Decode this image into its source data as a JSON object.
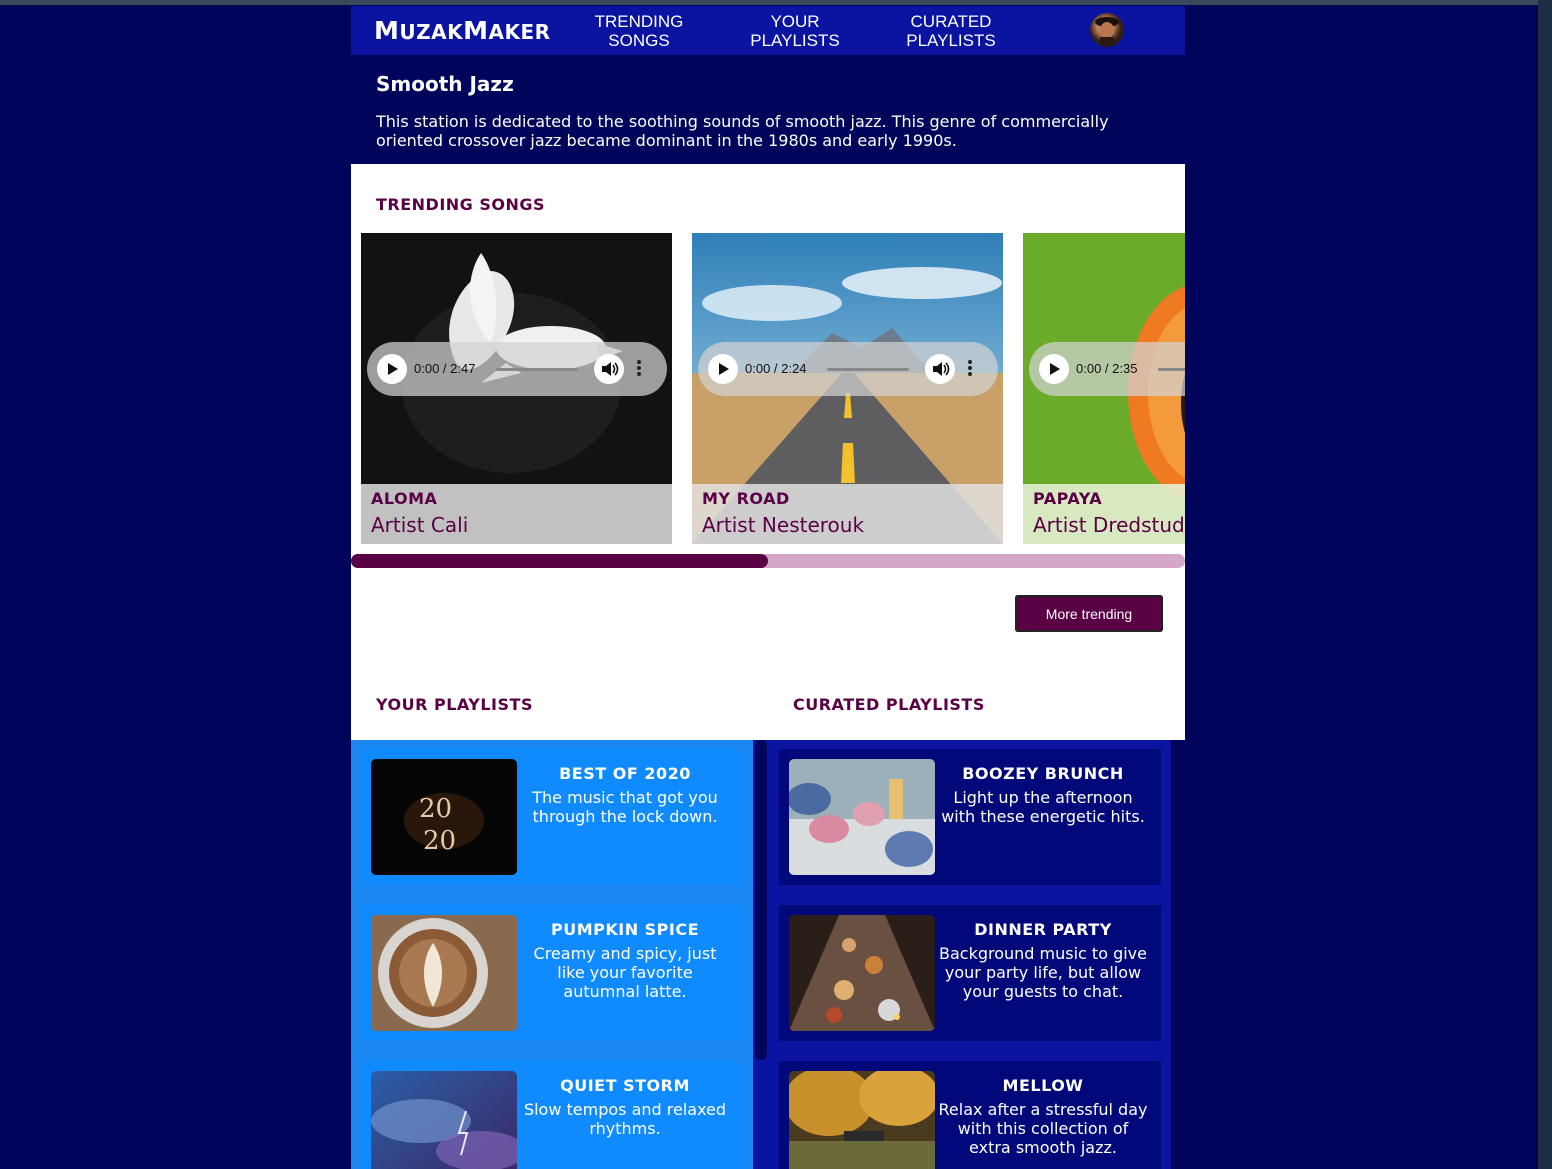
{
  "app": {
    "logo_first_big": "M",
    "logo_first_rest": "UZAK",
    "logo_second_big": "M",
    "logo_second_rest": "AKER"
  },
  "nav": {
    "links": [
      {
        "line1": "TRENDING",
        "line2": "SONGS"
      },
      {
        "line1": "YOUR",
        "line2": "PLAYLISTS"
      },
      {
        "line1": "CURATED",
        "line2": "PLAYLISTS"
      }
    ]
  },
  "station": {
    "title": "Smooth Jazz",
    "description": "This station is dedicated to the soothing sounds of smooth jazz. This genre of commercially oriented crossover jazz became dominant in the 1980s and early 1990s."
  },
  "trending": {
    "heading": "TRENDING SONGS",
    "songs": [
      {
        "title": "ALOMA",
        "artist": "Artist  Cali",
        "time": "0:00 / 2:47",
        "progress": 0
      },
      {
        "title": "MY ROAD",
        "artist": "Artist  Nesterouk",
        "time": "0:00 / 2:24",
        "progress": 0
      },
      {
        "title": "PAPAYA",
        "artist": "Artist  Dredstudio",
        "time": "0:00 / 2:35",
        "progress": 0
      }
    ],
    "scroll_position": 0.5,
    "more_label": "More trending"
  },
  "your_playlists": {
    "heading": "YOUR PLAYLISTS",
    "items": [
      {
        "title": "BEST OF 2020",
        "desc": "The music that got you through the lock down."
      },
      {
        "title": "PUMPKIN SPICE",
        "desc": "Creamy and spicy, just like your favorite autumnal latte."
      },
      {
        "title": "QUIET STORM",
        "desc": "Slow tempos and relaxed rhythms."
      }
    ]
  },
  "curated_playlists": {
    "heading": "CURATED PLAYLISTS",
    "items": [
      {
        "title": "BOOZEY BRUNCH",
        "desc": "Light up the afternoon with these energetic hits."
      },
      {
        "title": "DINNER PARTY",
        "desc": "Background music to give your party life, but allow your guests to chat."
      },
      {
        "title": "MELLOW",
        "desc": "Relax after a stressful day with this collection of extra smooth jazz."
      }
    ]
  },
  "icons": [
    "play-icon",
    "volume-icon",
    "more-options-icon",
    "avatar"
  ],
  "colors": {
    "navy": "#00045a",
    "nav_blue": "#0a14a0",
    "plum": "#5a0045",
    "sky": "#0f8bff"
  }
}
